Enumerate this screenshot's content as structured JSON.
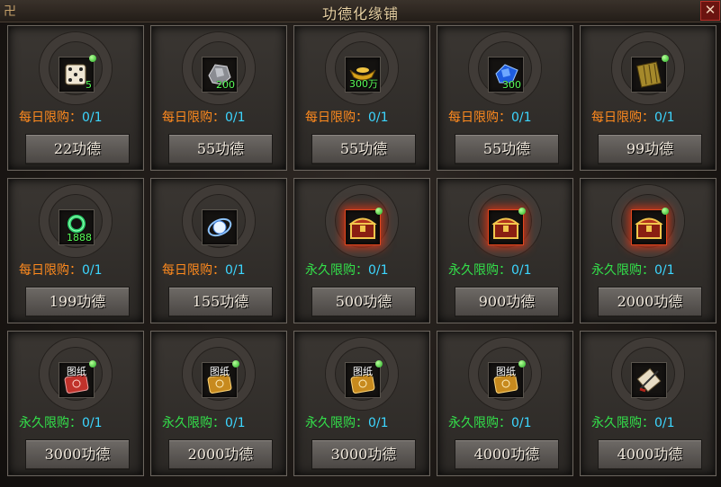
{
  "window": {
    "title": "功德化缘铺",
    "close_label": "✕",
    "ornament": "卍"
  },
  "colors": {
    "daily": "#ff8a1e",
    "permanent": "#33e04a",
    "count": "#3cd6ff"
  },
  "items": [
    {
      "icon": "dice-icon",
      "qty": "5",
      "gem": true,
      "label": "",
      "limit_label": "每日限购：",
      "limit_count": "0/1",
      "kind": "daily",
      "price": "22功德",
      "glow": false
    },
    {
      "icon": "ore-icon",
      "qty": "200",
      "gem": false,
      "label": "",
      "limit_label": "每日限购：",
      "limit_count": "0/1",
      "kind": "daily",
      "price": "55功德",
      "glow": false
    },
    {
      "icon": "gold-ingot-icon",
      "qty": "300万",
      "gem": false,
      "label": "",
      "limit_label": "每日限购：",
      "limit_count": "0/1",
      "kind": "daily",
      "price": "55功德",
      "glow": false
    },
    {
      "icon": "blue-crystal-icon",
      "qty": "300",
      "gem": false,
      "label": "",
      "limit_label": "每日限购：",
      "limit_count": "0/1",
      "kind": "daily",
      "price": "55功德",
      "glow": false
    },
    {
      "icon": "bamboo-scroll-icon",
      "qty": "",
      "gem": true,
      "label": "",
      "limit_label": "每日限购：",
      "limit_count": "0/1",
      "kind": "daily",
      "price": "99功德",
      "glow": false
    },
    {
      "icon": "green-ring-icon",
      "qty": "1888",
      "gem": false,
      "label": "",
      "limit_label": "每日限购：",
      "limit_count": "0/1",
      "kind": "daily",
      "price": "199功德",
      "glow": false
    },
    {
      "icon": "blue-orb-icon",
      "qty": "",
      "gem": false,
      "label": "",
      "limit_label": "每日限购：",
      "limit_count": "0/1",
      "kind": "daily",
      "price": "155功德",
      "glow": false
    },
    {
      "icon": "treasure-chest-icon",
      "qty": "",
      "gem": true,
      "label": "",
      "limit_label": "永久限购：",
      "limit_count": "0/1",
      "kind": "perm",
      "price": "500功德",
      "glow": true
    },
    {
      "icon": "treasure-chest-icon",
      "qty": "",
      "gem": true,
      "label": "",
      "limit_label": "永久限购：",
      "limit_count": "0/1",
      "kind": "perm",
      "price": "900功德",
      "glow": true
    },
    {
      "icon": "treasure-chest-icon",
      "qty": "",
      "gem": true,
      "label": "",
      "limit_label": "永久限购：",
      "limit_count": "0/1",
      "kind": "perm",
      "price": "2000功德",
      "glow": true
    },
    {
      "icon": "red-blueprint-icon",
      "qty": "",
      "gem": true,
      "label": "图纸",
      "limit_label": "永久限购：",
      "limit_count": "0/1",
      "kind": "perm",
      "price": "3000功德",
      "glow": false
    },
    {
      "icon": "gold-blueprint-icon",
      "qty": "",
      "gem": true,
      "label": "图纸",
      "limit_label": "永久限购：",
      "limit_count": "0/1",
      "kind": "perm",
      "price": "2000功德",
      "glow": false
    },
    {
      "icon": "gold-blueprint-icon",
      "qty": "",
      "gem": true,
      "label": "图纸",
      "limit_label": "永久限购：",
      "limit_count": "0/1",
      "kind": "perm",
      "price": "3000功德",
      "glow": false
    },
    {
      "icon": "gold-blueprint-icon",
      "qty": "",
      "gem": true,
      "label": "图纸",
      "limit_label": "永久限购：",
      "limit_count": "0/1",
      "kind": "perm",
      "price": "4000功德",
      "glow": false
    },
    {
      "icon": "sword-scroll-icon",
      "qty": "",
      "gem": false,
      "label": "",
      "limit_label": "永久限购：",
      "limit_count": "0/1",
      "kind": "perm",
      "price": "4000功德",
      "glow": false
    }
  ]
}
